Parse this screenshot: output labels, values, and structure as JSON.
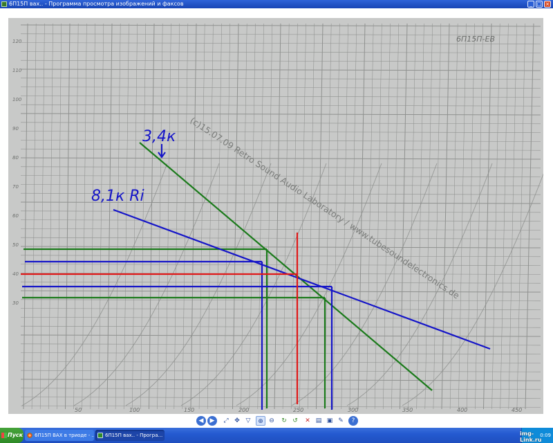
{
  "window": {
    "title": "6П15П вах.. - Программа просмотра изображений и факсов",
    "min_label": "_",
    "max_label": "□",
    "close_label": "×"
  },
  "scan": {
    "corner_label": "6П15П-ЕВ",
    "watermark": "(c)15.07.09 Retro Sound Audio Laboratory / www.tubesoundelectronics.de",
    "annotation_34k": "3,4к",
    "annotation_81k": "8,1к Ri",
    "y_ticks": [
      "120",
      "110",
      "100",
      "90",
      "80",
      "70",
      "60",
      "50",
      "40",
      "30"
    ],
    "x_ticks": [
      "50",
      "100",
      "150",
      "200",
      "250",
      "300",
      "350",
      "400",
      "450"
    ],
    "colors": {
      "green": "#1a7a1a",
      "blue": "#1414c8",
      "red": "#e01818",
      "grid": "#8f918f"
    }
  },
  "toolbar": {
    "buttons": [
      "previous-icon",
      "next-icon",
      "best-fit-icon",
      "actual-size-icon",
      "slideshow-icon",
      "zoom-in-icon",
      "zoom-out-icon",
      "rotate-clockwise-icon",
      "rotate-counterclockwise-icon",
      "delete-icon",
      "print-icon",
      "save-icon",
      "edit-icon",
      "help-icon"
    ]
  },
  "taskbar": {
    "start_label": "Пуск",
    "task1_label": "6П15П ВАХ в триоде - ...",
    "task2_label": "6П15П вах.. - Програ...",
    "clock": "0:09"
  },
  "watermark_logo": "img-Link.ru"
}
